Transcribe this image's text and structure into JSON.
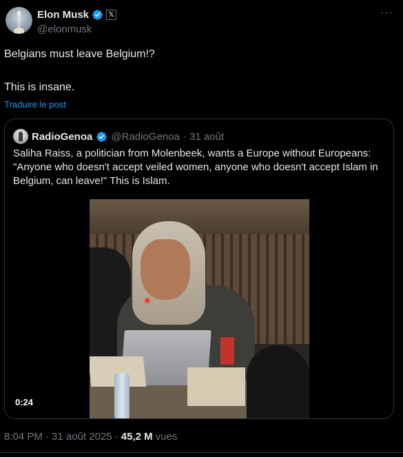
{
  "author": {
    "name": "Elon Musk",
    "handle": "@elonmusk",
    "affiliate_badge": "𝕏"
  },
  "more_menu": "···",
  "tweet": {
    "line1": "Belgians must leave Belgium!?",
    "line2": "This is insane.",
    "translate_label": "Traduire le post"
  },
  "quote": {
    "name": "RadioGenoa",
    "handle": "@RadioGenoa",
    "date": "· 31 août",
    "text": "Saliha Raiss, a politician from Molenbeek, wants a Europe without Europeans: \"Anyone who doesn't accept veiled women, anyone who doesn't accept Islam in Belgium, can leave!\" This is Islam.",
    "video_duration": "0:24"
  },
  "meta": {
    "time": "8:04 PM",
    "date": "· 31 août 2025 ·",
    "views_count": "45,2 M",
    "views_label": "vues"
  },
  "colors": {
    "background": "#000000",
    "text": "#e7e9ea",
    "muted": "#71767b",
    "link": "#1d9bf0",
    "verified": "#1d9bf0",
    "border": "#2f3336"
  },
  "icons": [
    "verified-badge-icon",
    "x-affiliate-icon",
    "more-options-icon"
  ]
}
